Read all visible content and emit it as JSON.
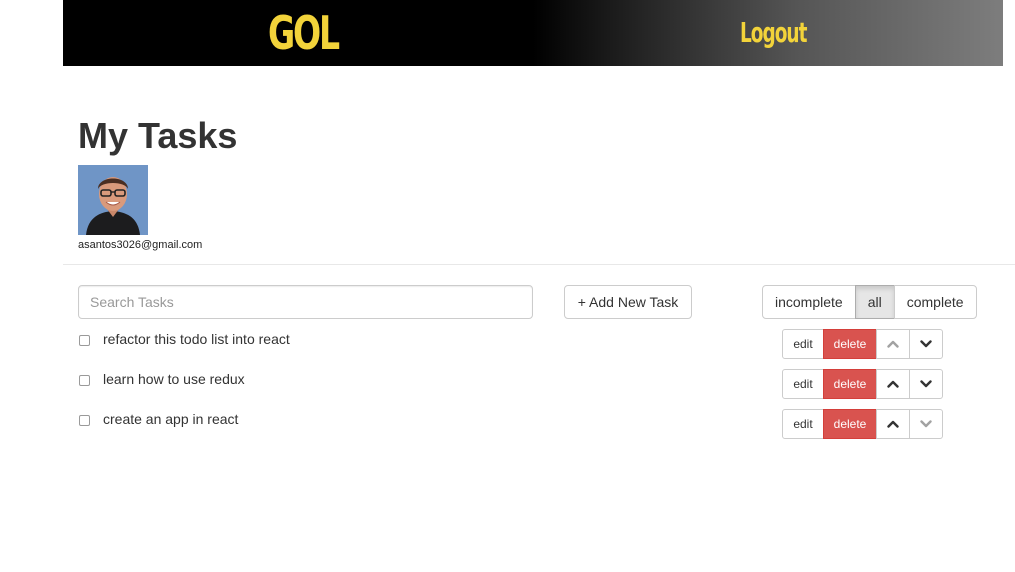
{
  "header": {
    "brand": "GOL",
    "logout_label": "Logout",
    "accent_color": "#f2d33a"
  },
  "main": {
    "title": "My Tasks",
    "user_email": "asantos3026@gmail.com"
  },
  "toolbar": {
    "search_placeholder": "Search Tasks",
    "search_value": "",
    "add_task_label": "+ Add New Task",
    "filters": [
      "incomplete",
      "all",
      "complete"
    ],
    "active_filter": "all"
  },
  "tasks": [
    {
      "label": "refactor this todo list into react",
      "checked": false,
      "up_enabled": false,
      "down_enabled": true
    },
    {
      "label": "learn how to use redux",
      "checked": false,
      "up_enabled": true,
      "down_enabled": true
    },
    {
      "label": "create an app in react",
      "checked": false,
      "up_enabled": true,
      "down_enabled": false
    }
  ],
  "task_actions": {
    "edit_label": "edit",
    "delete_label": "delete",
    "up_icon": "chevron-up-icon",
    "down_icon": "chevron-down-icon",
    "delete_color": "#d9534f"
  }
}
